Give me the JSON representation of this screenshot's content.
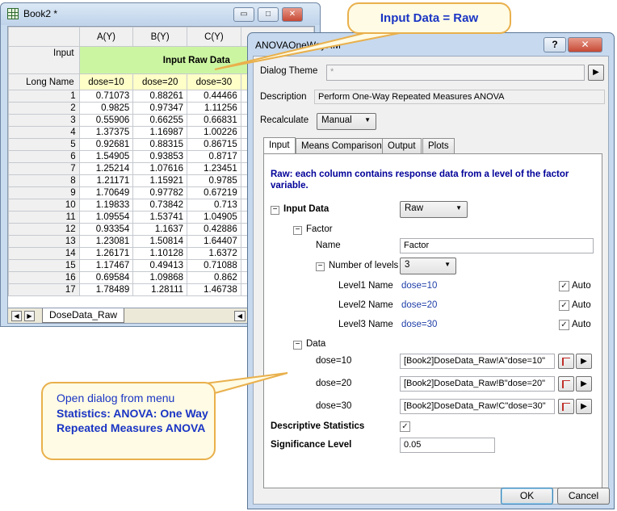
{
  "book": {
    "title": "Book2 *",
    "min_glyph": "▭",
    "max_glyph": "□",
    "close_glyph": "✕",
    "columns": [
      "A(Y)",
      "B(Y)",
      "C(Y)"
    ],
    "input_label": "Input",
    "input_raw_label": "Input Raw Data",
    "long_name_label": "Long Name",
    "long_names": [
      "dose=10",
      "dose=20",
      "dose=30"
    ],
    "rows": [
      [
        "1",
        "0.71073",
        "0.88261",
        "0.44466"
      ],
      [
        "2",
        "0.9825",
        "0.97347",
        "1.11256"
      ],
      [
        "3",
        "0.55906",
        "0.66255",
        "0.66831"
      ],
      [
        "4",
        "1.37375",
        "1.16987",
        "1.00226"
      ],
      [
        "5",
        "0.92681",
        "0.88315",
        "0.86715"
      ],
      [
        "6",
        "1.54905",
        "0.93853",
        "0.8717"
      ],
      [
        "7",
        "1.25214",
        "1.07616",
        "1.23451"
      ],
      [
        "8",
        "1.21171",
        "1.15921",
        "0.9785"
      ],
      [
        "9",
        "1.70649",
        "0.97782",
        "0.67219"
      ],
      [
        "10",
        "1.19833",
        "0.73842",
        "0.713"
      ],
      [
        "11",
        "1.09554",
        "1.53741",
        "1.04905"
      ],
      [
        "12",
        "0.93354",
        "1.1637",
        "0.42886"
      ],
      [
        "13",
        "1.23081",
        "1.50814",
        "1.64407"
      ],
      [
        "14",
        "1.26171",
        "1.10128",
        "1.6372"
      ],
      [
        "15",
        "1.17467",
        "0.49413",
        "0.71088"
      ],
      [
        "16",
        "0.69584",
        "1.09868",
        "0.862"
      ],
      [
        "17",
        "1.78489",
        "1.28111",
        "1.46738"
      ]
    ],
    "sheet_tab": "DoseData_Raw"
  },
  "dialog": {
    "title": "ANOVAOneWayRM",
    "help_glyph": "?",
    "close_glyph": "✕",
    "theme_label": "Dialog Theme",
    "theme_value": "*",
    "description_label": "Description",
    "description_value": "Perform One-Way Repeated Measures ANOVA",
    "recalculate_label": "Recalculate",
    "recalculate_value": "Manual",
    "tabs": [
      "Input",
      "Means Comparison",
      "Output",
      "Plots"
    ],
    "note": "Raw: each column contains response data from a level of the factor variable.",
    "input_data_label": "Input Data",
    "input_data_value": "Raw",
    "factor_label": "Factor",
    "name_label": "Name",
    "name_value": "Factor",
    "num_levels_label": "Number of levels",
    "num_levels_value": "3",
    "levels": [
      {
        "label": "Level1 Name",
        "value": "dose=10",
        "auto": "Auto"
      },
      {
        "label": "Level2 Name",
        "value": "dose=20",
        "auto": "Auto"
      },
      {
        "label": "Level3 Name",
        "value": "dose=30",
        "auto": "Auto"
      }
    ],
    "data_label": "Data",
    "data_rows": [
      {
        "label": "dose=10",
        "value": "[Book2]DoseData_Raw!A\"dose=10\""
      },
      {
        "label": "dose=20",
        "value": "[Book2]DoseData_Raw!B\"dose=20\""
      },
      {
        "label": "dose=30",
        "value": "[Book2]DoseData_Raw!C\"dose=30\""
      }
    ],
    "descriptive_stats_label": "Descriptive Statistics",
    "significance_label": "Significance Level",
    "significance_value": "0.05",
    "ok_label": "OK",
    "cancel_label": "Cancel"
  },
  "callouts": {
    "top": "Input Data = Raw",
    "bottom_line1": "Open dialog from menu",
    "bottom_line2": "Statistics: ANOVA: One Way Repeated Measures ANOVA"
  },
  "colors": {
    "callout_text": "#1a35c4",
    "callout_border": "#e9b04c",
    "input_raw_bg": "#ccf5a2",
    "long_name_bg": "#ffffc8",
    "note_text": "#000099"
  }
}
